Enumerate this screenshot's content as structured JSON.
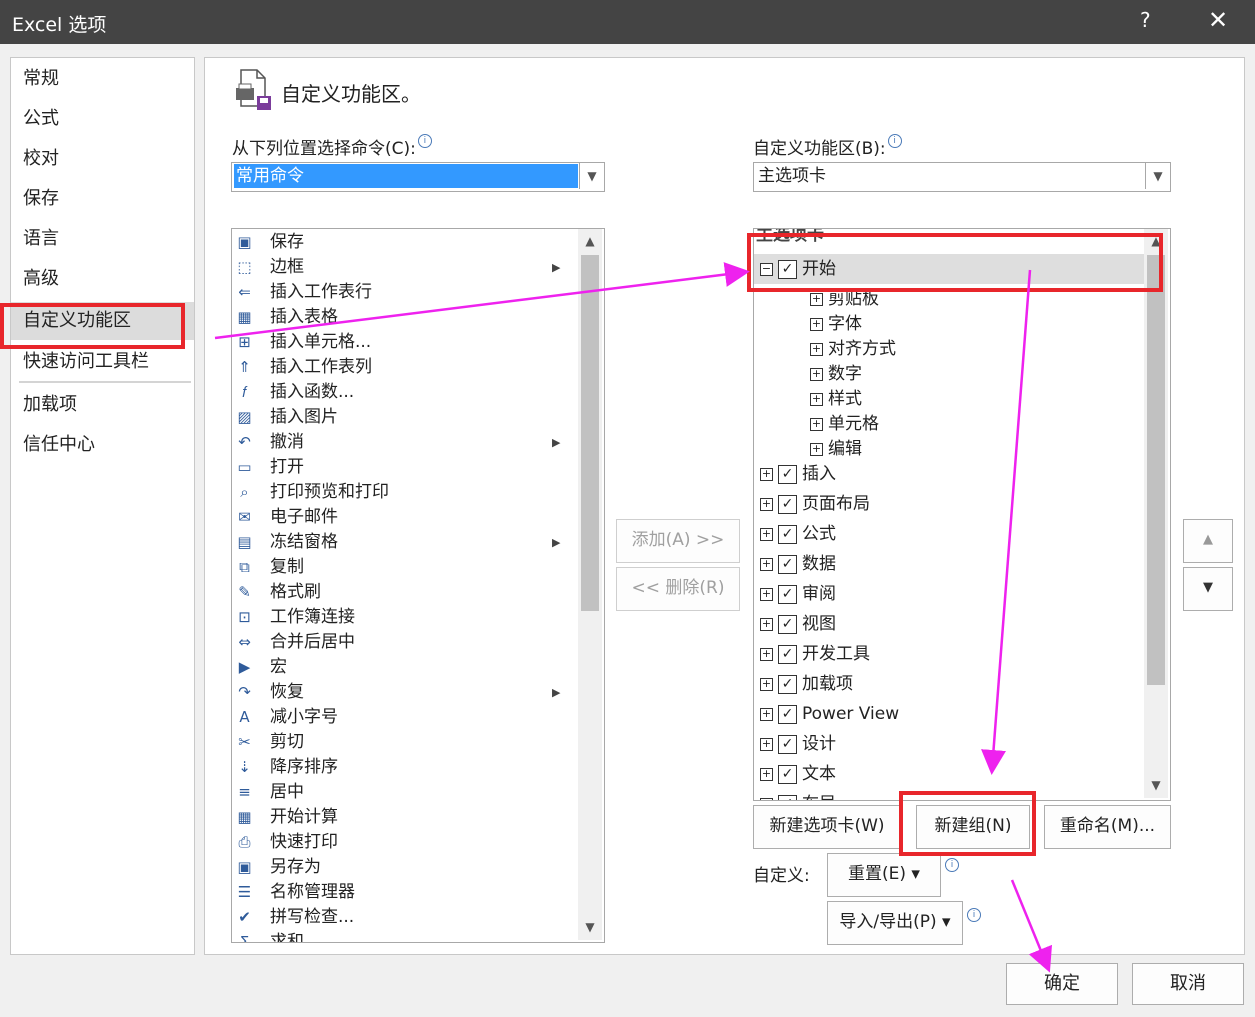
{
  "window": {
    "title": "Excel 选项",
    "help": "?",
    "close": "✕"
  },
  "nav": {
    "items": [
      "常规",
      "公式",
      "校对",
      "保存",
      "语言",
      "高级",
      "自定义功能区",
      "快速访问工具栏",
      "加载项",
      "信任中心"
    ],
    "selected": "自定义功能区"
  },
  "header": {
    "title": "自定义功能区。"
  },
  "left": {
    "label": "从下列位置选择命令(C):",
    "combo_value": "常用命令",
    "commands": [
      {
        "label": "保存",
        "icon": "save-icon"
      },
      {
        "label": "边框",
        "icon": "border-icon",
        "submenu": true
      },
      {
        "label": "插入工作表行",
        "icon": "insert-row-icon"
      },
      {
        "label": "插入表格",
        "icon": "insert-table-icon"
      },
      {
        "label": "插入单元格...",
        "icon": "insert-cells-icon"
      },
      {
        "label": "插入工作表列",
        "icon": "insert-column-icon"
      },
      {
        "label": "插入函数...",
        "icon": "function-icon"
      },
      {
        "label": "插入图片",
        "icon": "picture-icon"
      },
      {
        "label": "撤消",
        "icon": "undo-icon",
        "submenu": true
      },
      {
        "label": "打开",
        "icon": "open-folder-icon"
      },
      {
        "label": "打印预览和打印",
        "icon": "print-preview-icon"
      },
      {
        "label": "电子邮件",
        "icon": "email-icon"
      },
      {
        "label": "冻结窗格",
        "icon": "freeze-panes-icon",
        "submenu": true
      },
      {
        "label": "复制",
        "icon": "copy-icon"
      },
      {
        "label": "格式刷",
        "icon": "format-painter-icon"
      },
      {
        "label": "工作簿连接",
        "icon": "workbook-connection-icon"
      },
      {
        "label": "合并后居中",
        "icon": "merge-center-icon"
      },
      {
        "label": "宏",
        "icon": "macro-icon"
      },
      {
        "label": "恢复",
        "icon": "redo-icon",
        "submenu": true
      },
      {
        "label": "减小字号",
        "icon": "decrease-font-icon"
      },
      {
        "label": "剪切",
        "icon": "cut-icon"
      },
      {
        "label": "降序排序",
        "icon": "sort-descending-icon"
      },
      {
        "label": "居中",
        "icon": "center-align-icon"
      },
      {
        "label": "开始计算",
        "icon": "calculator-icon"
      },
      {
        "label": "快速打印",
        "icon": "quick-print-icon"
      },
      {
        "label": "另存为",
        "icon": "save-as-icon"
      },
      {
        "label": "名称管理器",
        "icon": "name-manager-icon"
      },
      {
        "label": "拼写检查...",
        "icon": "spell-check-icon"
      },
      {
        "label": "求和",
        "icon": "sum-icon"
      }
    ]
  },
  "middle": {
    "add": "添加(A) >>",
    "remove": "<< 删除(R)"
  },
  "right": {
    "label": "自定义功能区(B):",
    "combo_value": "主选项卡",
    "tree_header": "主选项卡",
    "tab_start": "开始",
    "groups": [
      "剪贴板",
      "字体",
      "对齐方式",
      "数字",
      "样式",
      "单元格",
      "编辑"
    ],
    "tabs": [
      "插入",
      "页面布局",
      "公式",
      "数据",
      "审阅",
      "视图",
      "开发工具",
      "加载项",
      "Power View",
      "设计",
      "文本",
      "布局"
    ],
    "new_tab": "新建选项卡(W)",
    "new_group": "新建组(N)",
    "rename": "重命名(M)...",
    "customize_label": "自定义:",
    "reset": "重置(E) ▾",
    "import_export": "导入/导出(P) ▾"
  },
  "footer": {
    "ok": "确定",
    "cancel": "取消"
  },
  "colors": {
    "titlebar": "#444444",
    "highlight_red": "#e8262b",
    "arrow_magenta": "#ee22ee",
    "combo_selected": "#3399ff"
  }
}
